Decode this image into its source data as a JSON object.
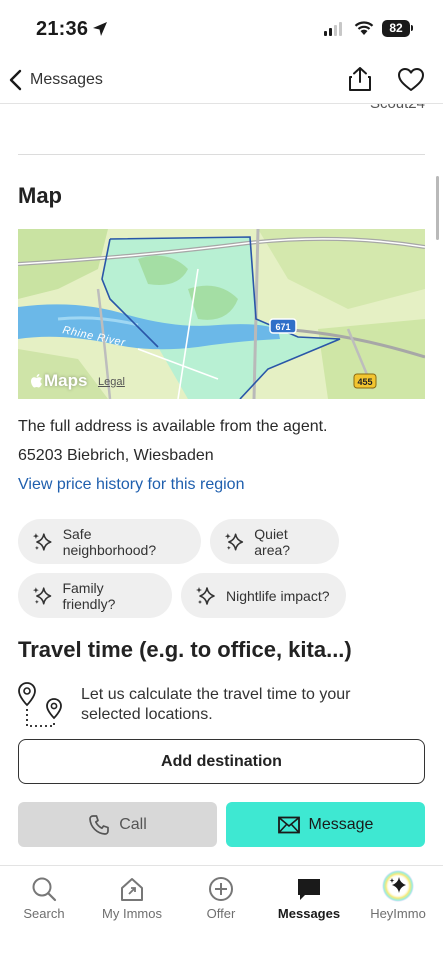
{
  "status_bar": {
    "time": "21:36",
    "battery": "82"
  },
  "header": {
    "back_label": "Messages",
    "cut_text": "Scout24"
  },
  "map_section": {
    "title": "Map",
    "river_label": "Rhine River",
    "road_badge_1": "671",
    "road_badge_2": "455",
    "maps_brand": "Maps",
    "legal_label": "Legal"
  },
  "address": {
    "note": "The full address is available from the agent.",
    "location": "65203 Biebrich, Wiesbaden",
    "price_history_link": "View price history for this region"
  },
  "chips": [
    {
      "label": "Safe neighborhood?"
    },
    {
      "label": "Quiet area?"
    },
    {
      "label": "Family friendly?"
    },
    {
      "label": "Nightlife impact?"
    }
  ],
  "travel": {
    "title": "Travel time (e.g. to office, kita...)",
    "description": "Let us calculate the travel time to your selected locations.",
    "add_button": "Add destination"
  },
  "actions": {
    "call_label": "Call",
    "message_label": "Message"
  },
  "tab_bar": {
    "tabs": [
      {
        "label": "Search",
        "icon": "search-icon"
      },
      {
        "label": "My Immos",
        "icon": "home-icon"
      },
      {
        "label": "Offer",
        "icon": "plus-circle-icon"
      },
      {
        "label": "Messages",
        "icon": "chat-icon",
        "active": true
      },
      {
        "label": "HeyImmo",
        "icon": "sparkle-icon"
      }
    ]
  },
  "colors": {
    "accent": "#3ee8d2",
    "link": "#1f5fae",
    "chip_bg": "#efefef"
  }
}
